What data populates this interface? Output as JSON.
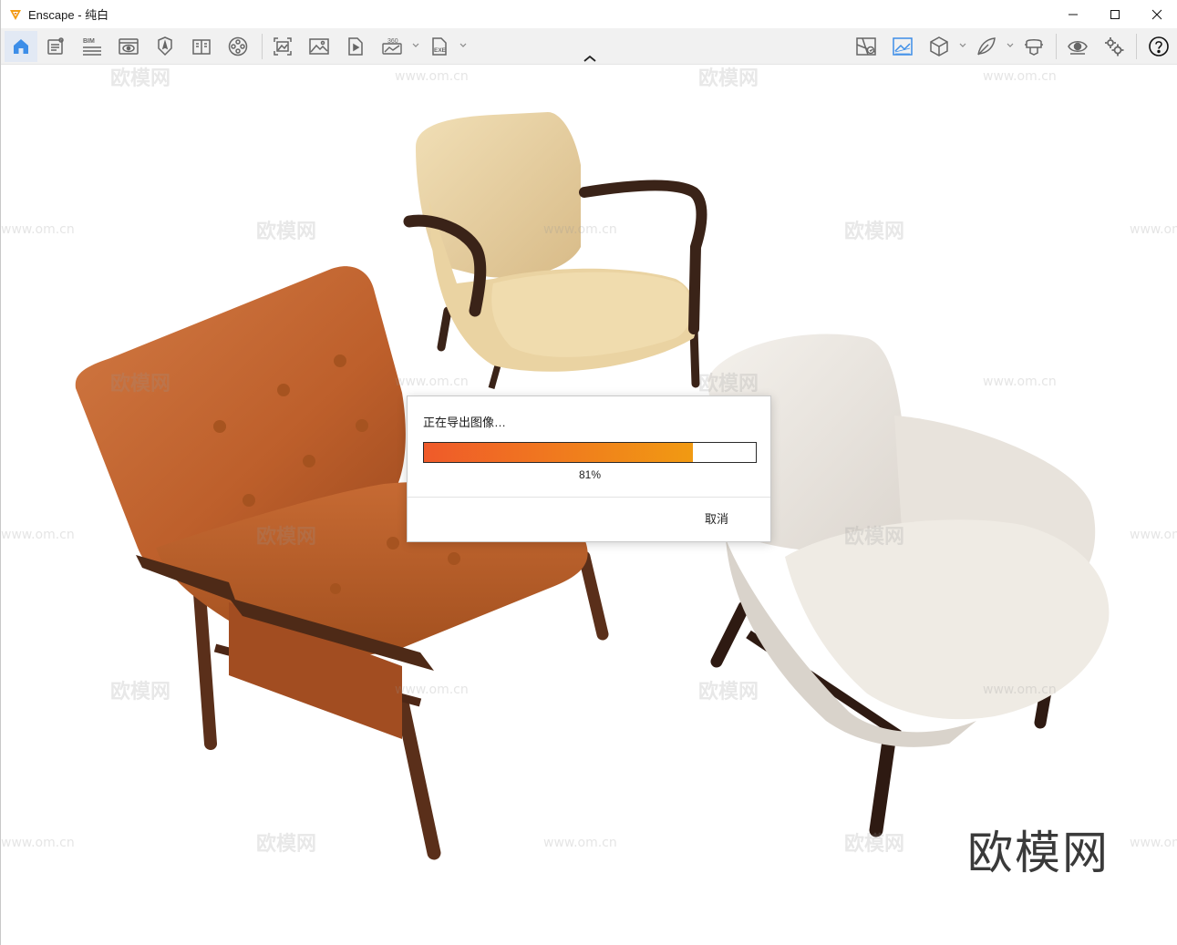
{
  "window": {
    "title": "Enscape - 纯白",
    "controls": [
      "minimize-icon",
      "maximize-icon",
      "close-icon"
    ]
  },
  "toolbar": {
    "left_icons": [
      "home-icon",
      "document-icon",
      "bim-icon",
      "view-icon",
      "navigation-icon",
      "book-icon",
      "film-reel-icon",
      "screenshot-icon",
      "image-icon",
      "video-icon",
      "panorama-360-icon",
      "exe-export-icon"
    ],
    "bim_label": "BIM",
    "pano_label": "360",
    "exe_label": "EXE",
    "right_icons": [
      "map-icon",
      "render-image-icon",
      "cube-icon",
      "leaf-icon",
      "vr-headset-icon",
      "eye-icon",
      "settings-icon",
      "help-icon"
    ]
  },
  "viewport": {
    "watermark_text": "欧模网",
    "watermark_url": "www.om.cn",
    "brand_logo": "欧模网"
  },
  "dialog": {
    "title": "正在导出图像…",
    "progress": 0.81,
    "progress_label": "81%",
    "cancel_label": "取消",
    "colors": {
      "fill_start": "#ef5a2a",
      "fill_end": "#f19a12"
    }
  }
}
